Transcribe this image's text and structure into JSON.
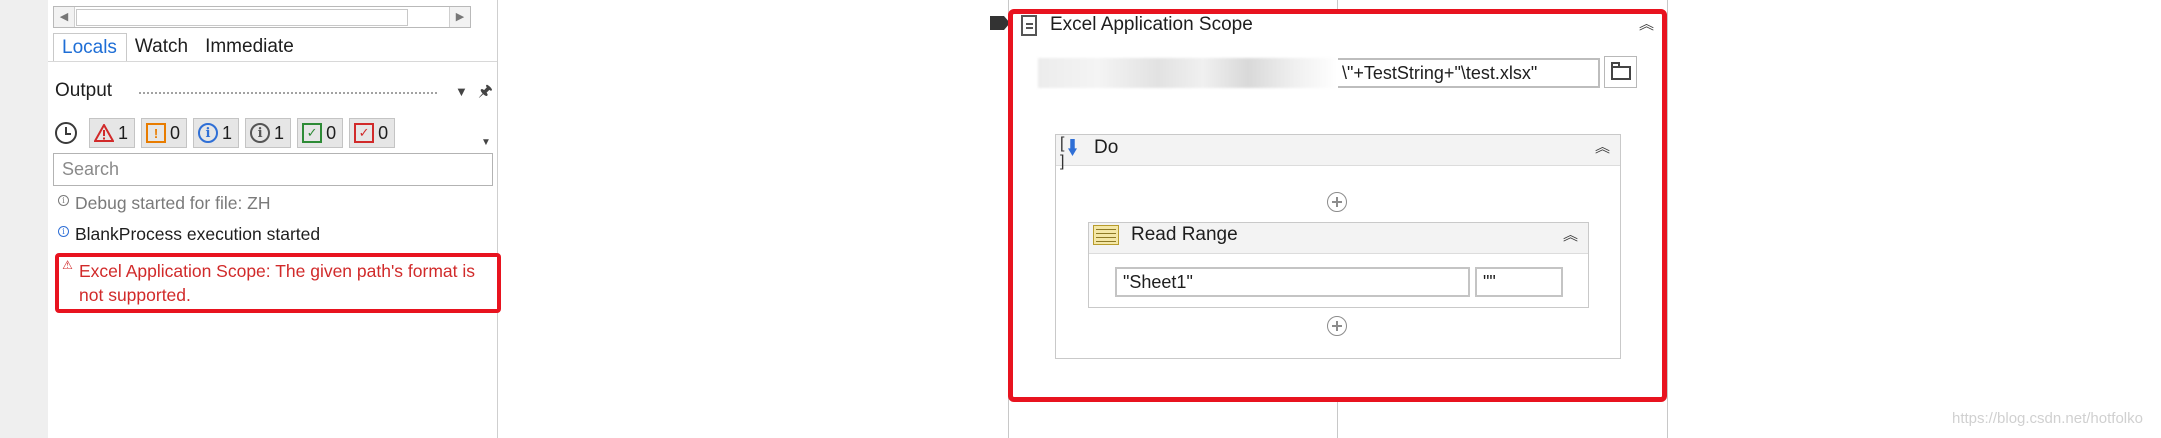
{
  "left_panel": {
    "tabs": [
      {
        "label": "Locals",
        "active": true
      },
      {
        "label": "Watch",
        "active": false
      },
      {
        "label": "Immediate",
        "active": false
      }
    ],
    "output": {
      "title": "Output",
      "filters": {
        "errors": "1",
        "warnings": "0",
        "info": "1",
        "trace": "1",
        "success": "0",
        "failed": "0"
      },
      "search_placeholder": "Search",
      "log": [
        {
          "level": "debug",
          "text": "Debug started for file: ZH"
        },
        {
          "level": "info",
          "text": "BlankProcess execution started"
        },
        {
          "level": "error",
          "text": "Excel Application Scope: The given path's format is not supported."
        }
      ]
    }
  },
  "designer": {
    "scope": {
      "title": "Excel Application Scope",
      "path_visible_text": "\\\"+TestString+\"\\test.xlsx\""
    },
    "do": {
      "title": "Do"
    },
    "read_range": {
      "title": "Read Range",
      "sheet_value": "\"Sheet1\"",
      "range_value": "\"\""
    }
  },
  "colors": {
    "highlight": "#e8131f",
    "error_text": "#d12a2a",
    "accent": "#1e6ed6"
  },
  "watermark": "https://blog.csdn.net/hotfolko"
}
